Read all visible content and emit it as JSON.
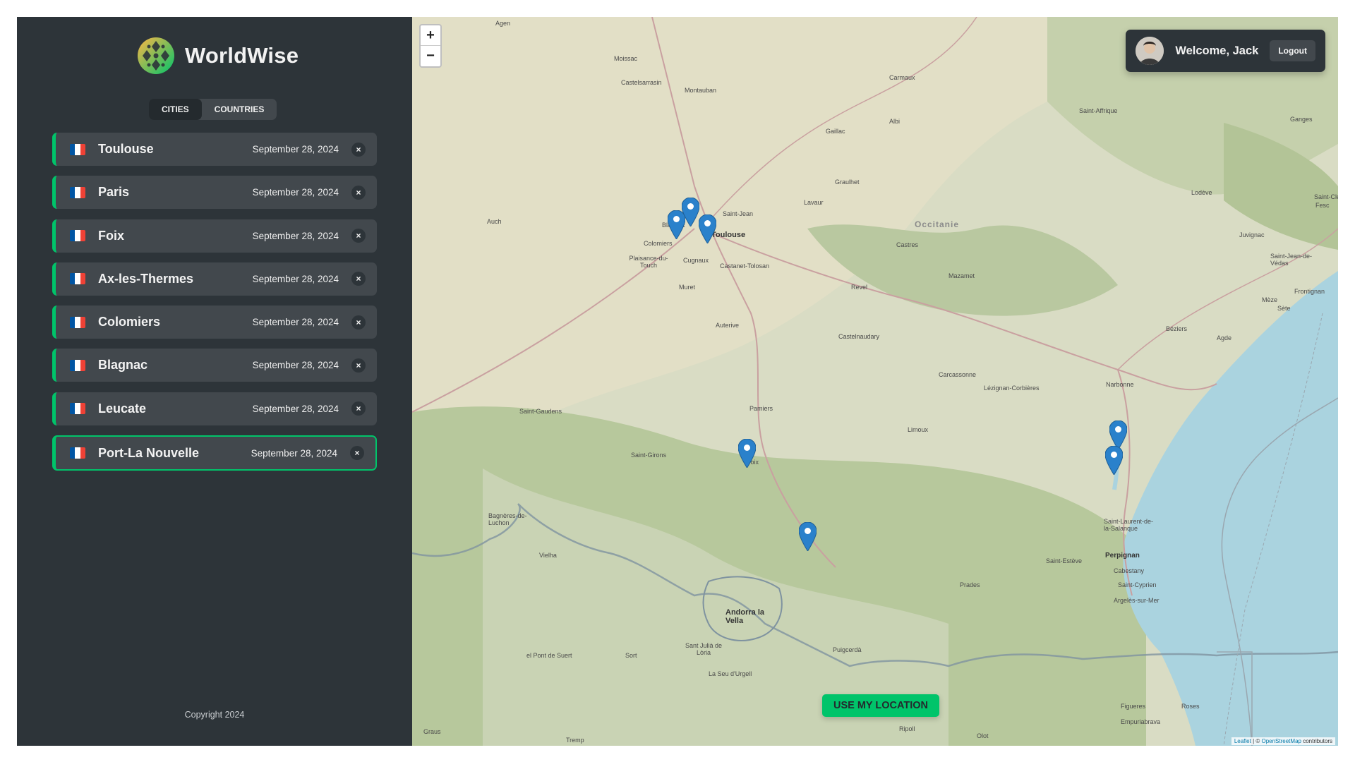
{
  "app": {
    "name": "WorldWise",
    "copyright": "Copyright 2024"
  },
  "tabs": [
    {
      "label": "Cities",
      "active": true
    },
    {
      "label": "Countries",
      "active": false
    }
  ],
  "cities": [
    {
      "name": "Toulouse",
      "date": "September 28, 2024",
      "flag": "fr",
      "delete": "×",
      "active": false
    },
    {
      "name": "Paris",
      "date": "September 28, 2024",
      "flag": "fr",
      "delete": "×",
      "active": false
    },
    {
      "name": "Foix",
      "date": "September 28, 2024",
      "flag": "fr",
      "delete": "×",
      "active": false
    },
    {
      "name": "Ax-les-Thermes",
      "date": "September 28, 2024",
      "flag": "fr",
      "delete": "×",
      "active": false
    },
    {
      "name": "Colomiers",
      "date": "September 28, 2024",
      "flag": "fr",
      "delete": "×",
      "active": false
    },
    {
      "name": "Blagnac",
      "date": "September 28, 2024",
      "flag": "fr",
      "delete": "×",
      "active": false
    },
    {
      "name": "Leucate",
      "date": "September 28, 2024",
      "flag": "fr",
      "delete": "×",
      "active": false
    },
    {
      "name": "Port-La Nouvelle",
      "date": "September 28, 2024",
      "flag": "fr",
      "delete": "×",
      "active": true
    }
  ],
  "map": {
    "zoom_in": "+",
    "zoom_out": "−",
    "use_location": "Use my location",
    "attribution_leaflet": "Leaflet",
    "attribution_sep": " | © ",
    "attribution_osm": "OpenStreetMap",
    "attribution_tail": " contributors",
    "labels": [
      "Agen",
      "Moissac",
      "Castelsarrasin",
      "Montauban",
      "Carmaux",
      "Saint-Affrique",
      "Ganges",
      "Gaillac",
      "Albi",
      "Graulhet",
      "Lavaur",
      "Auch",
      "Saint-Jean",
      "Toulouse",
      "Blagnac",
      "Colomiers",
      "Plaisance-du-Touch",
      "Cugnaux",
      "Castanet-Tolosan",
      "Occitanie",
      "Castres",
      "Mazamet",
      "Revel",
      "Muret",
      "Auterive",
      "Castelnaudary",
      "Lodève",
      "Juvignac",
      "Saint-Jean-de-Védas",
      "Frontignan",
      "Mèze",
      "Sète",
      "Béziers",
      "Agde",
      "Carcassonne",
      "Lézignan-Corbières",
      "Narbonne",
      "Pamiers",
      "Saint-Gaudens",
      "Limoux",
      "Saint-Girons",
      "Foix",
      "Bagnères-de-Luchon",
      "Vielha",
      "Saint-Laurent-de-la-Salanque",
      "Perpignan",
      "Saint-Estève",
      "Cabestany",
      "Saint-Cyprien",
      "Argelès-sur-Mer",
      "Prades",
      "Andorra la Vella",
      "Sant Julià de Lòria",
      "Puigcerdà",
      "La Seu d'Urgell",
      "el Pont de Suert",
      "Sort",
      "Figueres",
      "Roses",
      "Empuriabrava",
      "Graus",
      "Tremp",
      "Ripoll",
      "Olot",
      "Saint-Clé",
      "Fesc"
    ]
  },
  "user": {
    "welcome": "Welcome, Jack",
    "logout": "Logout"
  },
  "colors": {
    "brand": "#00c46a",
    "sidebar": "#2d3439",
    "item": "#42484d",
    "sea": "#aad3df",
    "marker": "#2a81cb"
  }
}
